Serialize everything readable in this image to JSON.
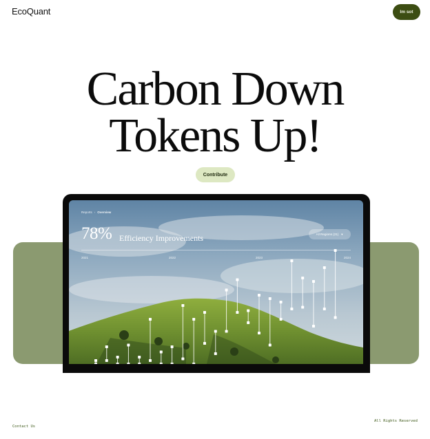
{
  "header": {
    "logo": "EcoQuant",
    "button_label": "Im sot"
  },
  "hero": {
    "title_line1": "Carbon Down",
    "title_line2": "Tokens Up!",
    "cta_label": "Contribute"
  },
  "dashboard": {
    "breadcrumb": [
      "Reports",
      "Overview"
    ],
    "metric_value": "78%",
    "metric_label": "Efficiency Improvements",
    "region_selector": "All Regions (21)",
    "years": [
      "2021",
      "2022",
      "2023",
      "2024"
    ]
  },
  "chart_data": {
    "type": "range",
    "x": [
      1,
      2,
      3,
      4,
      5,
      6,
      7,
      8,
      9,
      10,
      11,
      12,
      13,
      14,
      15,
      16,
      17,
      18,
      19,
      20,
      21,
      22,
      23
    ],
    "ranges": [
      [
        0.0,
        0.02
      ],
      [
        0.02,
        0.1
      ],
      [
        0.0,
        0.04
      ],
      [
        0.0,
        0.11
      ],
      [
        0.0,
        0.04
      ],
      [
        0.02,
        0.26
      ],
      [
        0.0,
        0.07
      ],
      [
        0.0,
        0.1
      ],
      [
        0.03,
        0.34
      ],
      [
        0.0,
        0.26
      ],
      [
        0.12,
        0.3
      ],
      [
        0.06,
        0.19
      ],
      [
        0.19,
        0.43
      ],
      [
        0.3,
        0.49
      ],
      [
        0.24,
        0.31
      ],
      [
        0.18,
        0.4
      ],
      [
        0.11,
        0.38
      ],
      [
        0.26,
        0.36
      ],
      [
        0.32,
        0.6
      ],
      [
        0.33,
        0.5
      ],
      [
        0.22,
        0.48
      ],
      [
        0.32,
        0.56
      ],
      [
        0.27,
        0.66
      ]
    ],
    "title": "",
    "xlabel": "",
    "ylabel": ""
  },
  "footer": {
    "contact": "Contact Us",
    "rights": "All Rights Reserved"
  },
  "colors": {
    "brand_dark": "#3c4d12",
    "cta_bg": "#dde8c2",
    "band": "#8b9a70",
    "footer_text": "#3f5a1a"
  }
}
